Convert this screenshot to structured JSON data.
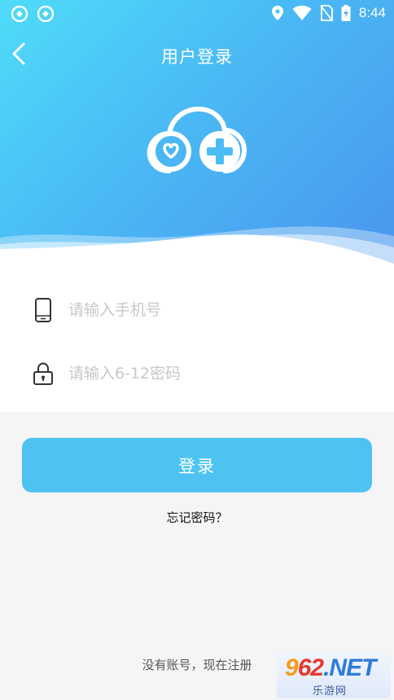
{
  "status_bar": {
    "time": "8:44",
    "left_icons": [
      "sync-icon",
      "sync-icon"
    ],
    "right_icons": [
      "location-icon",
      "wifi-icon",
      "no-sim-icon",
      "battery-charging-icon"
    ]
  },
  "header": {
    "title": "用户登录",
    "back_icon": "chevron-left-icon",
    "logo_icon": "health-cloud-icon",
    "gradient_colors": [
      "#4fdcf9",
      "#4ab9f4",
      "#4a94ee"
    ]
  },
  "form": {
    "phone": {
      "placeholder": "请输入手机号",
      "value": "",
      "icon": "phone-icon"
    },
    "password": {
      "placeholder": "请输入6-12密码",
      "value": "",
      "icon": "lock-icon"
    }
  },
  "actions": {
    "login_label": "登录",
    "login_color": "#4ec3f1",
    "forgot_label": "忘记密码？",
    "register_label": "没有账号，现在注册"
  },
  "watermark": {
    "main_a": "9",
    "main_b": "62",
    "main_c": ".NET",
    "sub": "乐游网"
  }
}
